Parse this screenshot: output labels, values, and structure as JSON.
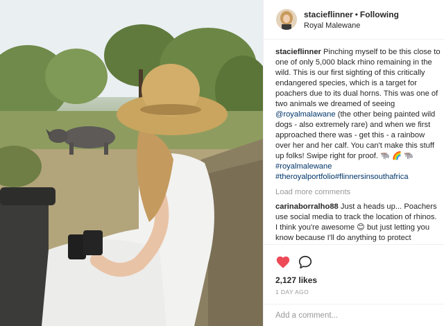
{
  "post": {
    "username": "stacieflinner",
    "follow_separator": "•",
    "follow_status": "Following",
    "location": "Royal Malewane"
  },
  "caption": {
    "username": "stacieflinner",
    "text_1": "Pinching myself to be this close to one of only 5,000 black rhino remaining in the wild. This is our first sighting of this critically endangered species, which is a target for poachers due to its dual horns. This was one of two animals we dreamed of seeing",
    "mention": "@royalmalawane",
    "text_2": "(the other being painted wild dogs - also extremely rare) and when we first approached there was - get this - a rainbow over her and her calf. You can't make this stuff up folks! Swipe right for proof. 🐃 🌈 🐃",
    "hashtag_1": "#royalmalewane",
    "hashtag_2": "#theroyalportfolio",
    "hashtag_3": "#flinnersinsouthafrica"
  },
  "load_more_label": "Load more comments",
  "comment": {
    "username": "carinaborralho88",
    "text": "Just a heads up... Poachers use social media to track the location of rhinos. I think you're awesome 😊 but just letting you know because I'll do anything to protect animals. So maybe don't"
  },
  "likes_text": "2,127 likes",
  "time_text": "1 DAY AGO",
  "add_comment_placeholder": "Add a comment...",
  "icons": {
    "like": "heart-filled-icon",
    "comment": "speech-bubble-icon",
    "like_color": "#ed4956"
  }
}
